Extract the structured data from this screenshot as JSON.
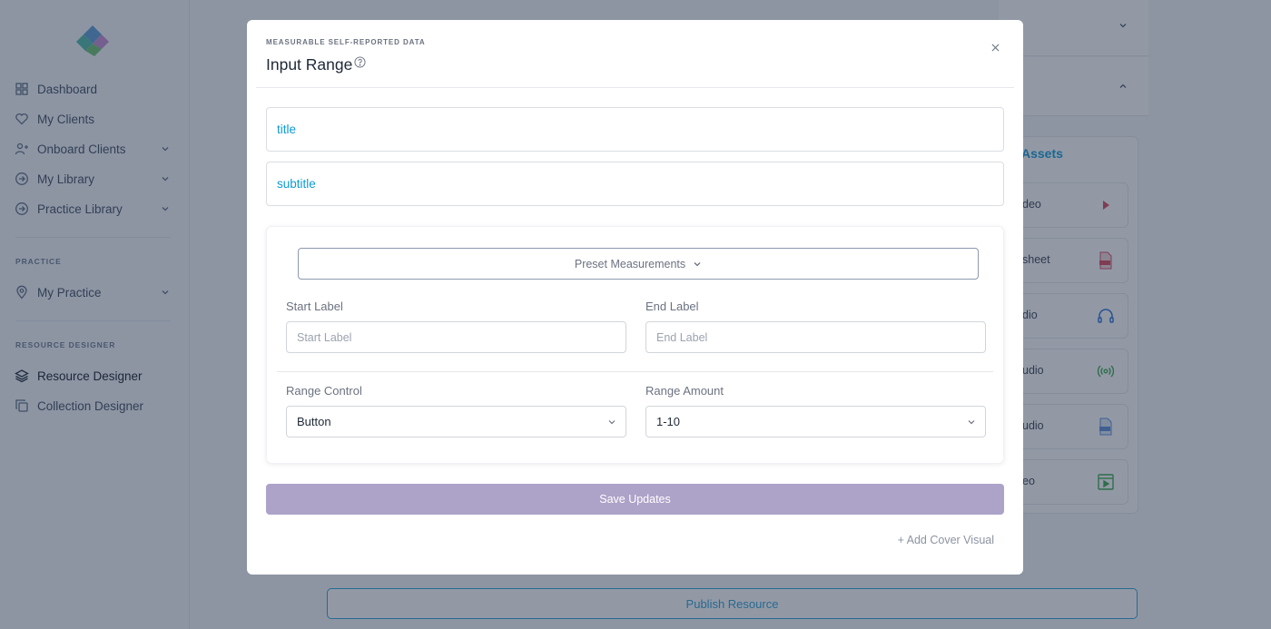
{
  "sidebar": {
    "items": [
      {
        "label": "Dashboard",
        "icon": "grid-icon"
      },
      {
        "label": "My Clients",
        "icon": "heart-icon"
      },
      {
        "label": "Onboard Clients",
        "icon": "user-plus-icon"
      },
      {
        "label": "My Library",
        "icon": "arrow-circle-icon"
      },
      {
        "label": "Practice Library",
        "icon": "arrow-circle-icon"
      }
    ],
    "practice_label": "PRACTICE",
    "practice_items": [
      {
        "label": "My Practice",
        "icon": "map-pin-icon"
      }
    ],
    "designer_label": "RESOURCE DESIGNER",
    "designer_items": [
      {
        "label": "Resource Designer",
        "icon": "layers-icon"
      },
      {
        "label": "Collection Designer",
        "icon": "copy-icon"
      }
    ]
  },
  "background": {
    "assets_title": "Assets",
    "assets": [
      {
        "label": "deo",
        "icon": "play-icon"
      },
      {
        "label": "sheet",
        "icon": "pdf-icon"
      },
      {
        "label": "dio",
        "icon": "ai-audio-icon"
      },
      {
        "label": "udio",
        "icon": "broadcast-icon"
      },
      {
        "label": "udio",
        "icon": "audio-file-icon"
      },
      {
        "label": "eo",
        "icon": "video-file-icon"
      }
    ],
    "publish_label": "Publish Resource"
  },
  "modal": {
    "eyebrow": "MEASURABLE SELF-REPORTED DATA",
    "title": "Input Range",
    "close_symbol": "×",
    "title_value": "title",
    "subtitle_value": "subtitle",
    "preset_label": "Preset Measurements",
    "start_label": "Start Label",
    "start_placeholder": "Start Label",
    "end_label": "End Label",
    "end_placeholder": "End Label",
    "range_control_label": "Range Control",
    "range_control_value": "Button",
    "range_amount_label": "Range Amount",
    "range_amount_value": "1-10",
    "save_label": "Save Updates",
    "add_cover_label": "+ Add Cover Visual"
  },
  "colors": {
    "accent": "#0e9bd6",
    "save_button": "#ada2c8",
    "overlay": "rgba(38,52,76,0.5)"
  }
}
